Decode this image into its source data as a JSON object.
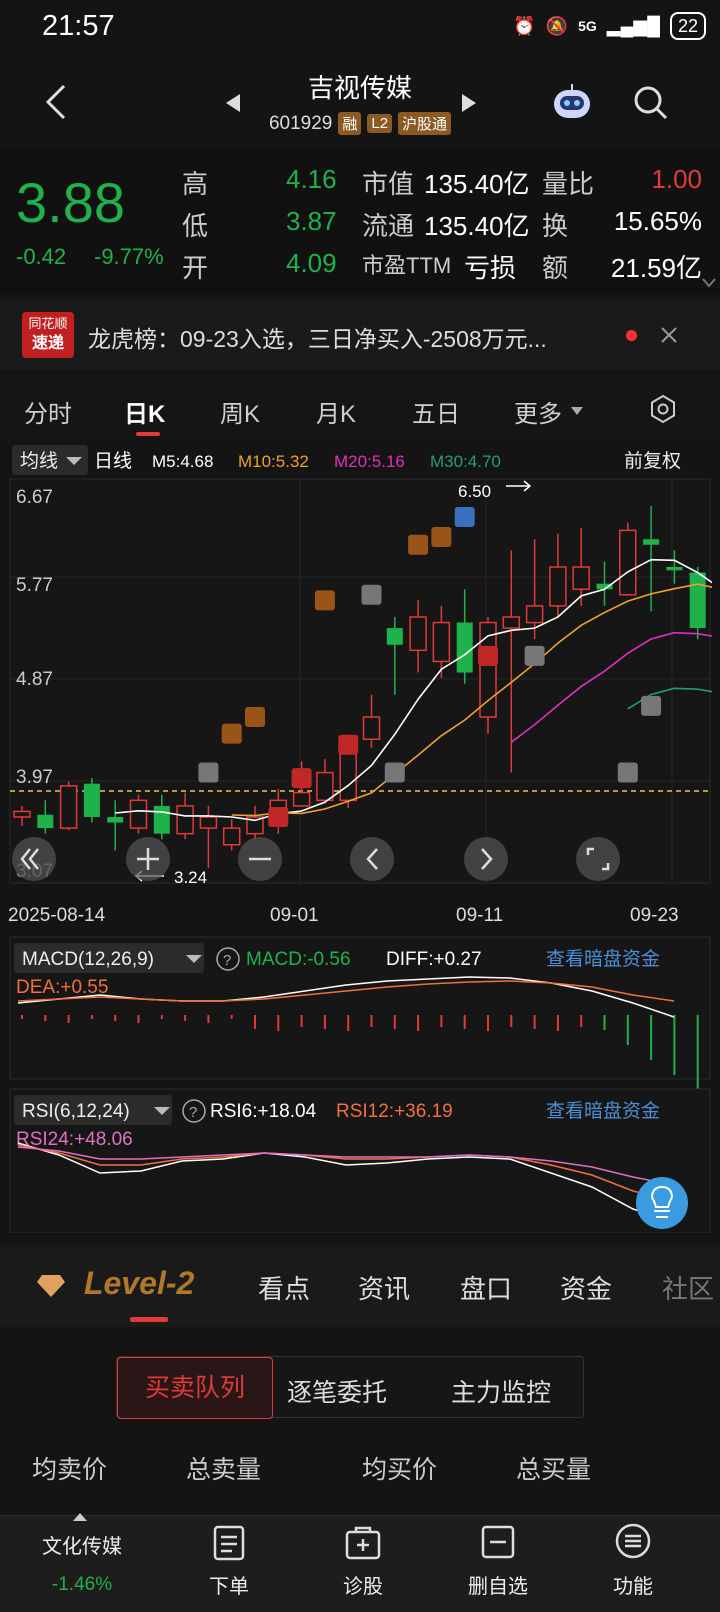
{
  "status": {
    "time": "21:57",
    "network": "5G",
    "battery": "22"
  },
  "header": {
    "stock_name": "吉视传媒",
    "stock_code": "601929",
    "tags": [
      "融",
      "L2",
      "沪股通"
    ]
  },
  "quote": {
    "price": "3.88",
    "change": "-0.42",
    "change_pct": "-9.77%",
    "high_label": "高",
    "high": "4.16",
    "low_label": "低",
    "low": "3.87",
    "open_label": "开",
    "open": "4.09",
    "mktcap_label": "市值",
    "mktcap": "135.40亿",
    "float_label": "流通",
    "float": "135.40亿",
    "pe_label": "市盈TTM",
    "pe": "亏损",
    "vr_label": "量比",
    "vr": "1.00",
    "turnover_label": "换",
    "turnover": "15.65%",
    "amount_label": "额",
    "amount": "21.59亿"
  },
  "news": {
    "logo_top": "同花顺",
    "logo_bottom": "速递",
    "text": "龙虎榜：09-23入选，三日净买入-2508万元..."
  },
  "period_tabs": [
    "分时",
    "日K",
    "周K",
    "月K",
    "五日",
    "更多"
  ],
  "ma_bar": {
    "selector": "均线",
    "mode": "日线",
    "m5": "M5:4.68",
    "m10": "M10:5.32",
    "m20": "M20:5.16",
    "m30": "M30:4.70",
    "adjust": "前复权"
  },
  "kline": {
    "y_labels": [
      "6.67",
      "5.77",
      "4.87",
      "3.97",
      "3.07"
    ],
    "high_mark": "6.50",
    "low_mark": "3.24",
    "x_labels": [
      "2025-08-14",
      "09-01",
      "09-11",
      "09-23"
    ]
  },
  "macd": {
    "selector": "MACD(12,26,9)",
    "macd": "MACD:-0.56",
    "diff": "DIFF:+0.27",
    "dea": "DEA:+0.55",
    "link": "查看暗盘资金"
  },
  "rsi": {
    "selector": "RSI(6,12,24)",
    "rsi6": "RSI6:+18.04",
    "rsi12": "RSI12:+36.19",
    "rsi24": "RSI24:+48.06",
    "link": "查看暗盘资金"
  },
  "bottom_tabs": {
    "level2": "Level-2",
    "items": [
      "看点",
      "资讯",
      "盘口",
      "资金",
      "社区"
    ]
  },
  "sub_tabs": [
    "买卖队列",
    "逐笔委托",
    "主力监控"
  ],
  "order_cols": [
    "均卖价",
    "总卖量",
    "均买价",
    "总买量"
  ],
  "navbar": {
    "sector": "文化传媒",
    "sector_chg": "-1.46%",
    "items": [
      "下单",
      "诊股",
      "删自选",
      "功能"
    ]
  },
  "colors": {
    "up": "#e03a3a",
    "down": "#1fb24b",
    "accent": "#d4792a",
    "m5": "#ffffff",
    "m10": "#f0a030",
    "m20": "#e030c0",
    "m30": "#1fa070",
    "link": "#4c8fd6"
  }
}
